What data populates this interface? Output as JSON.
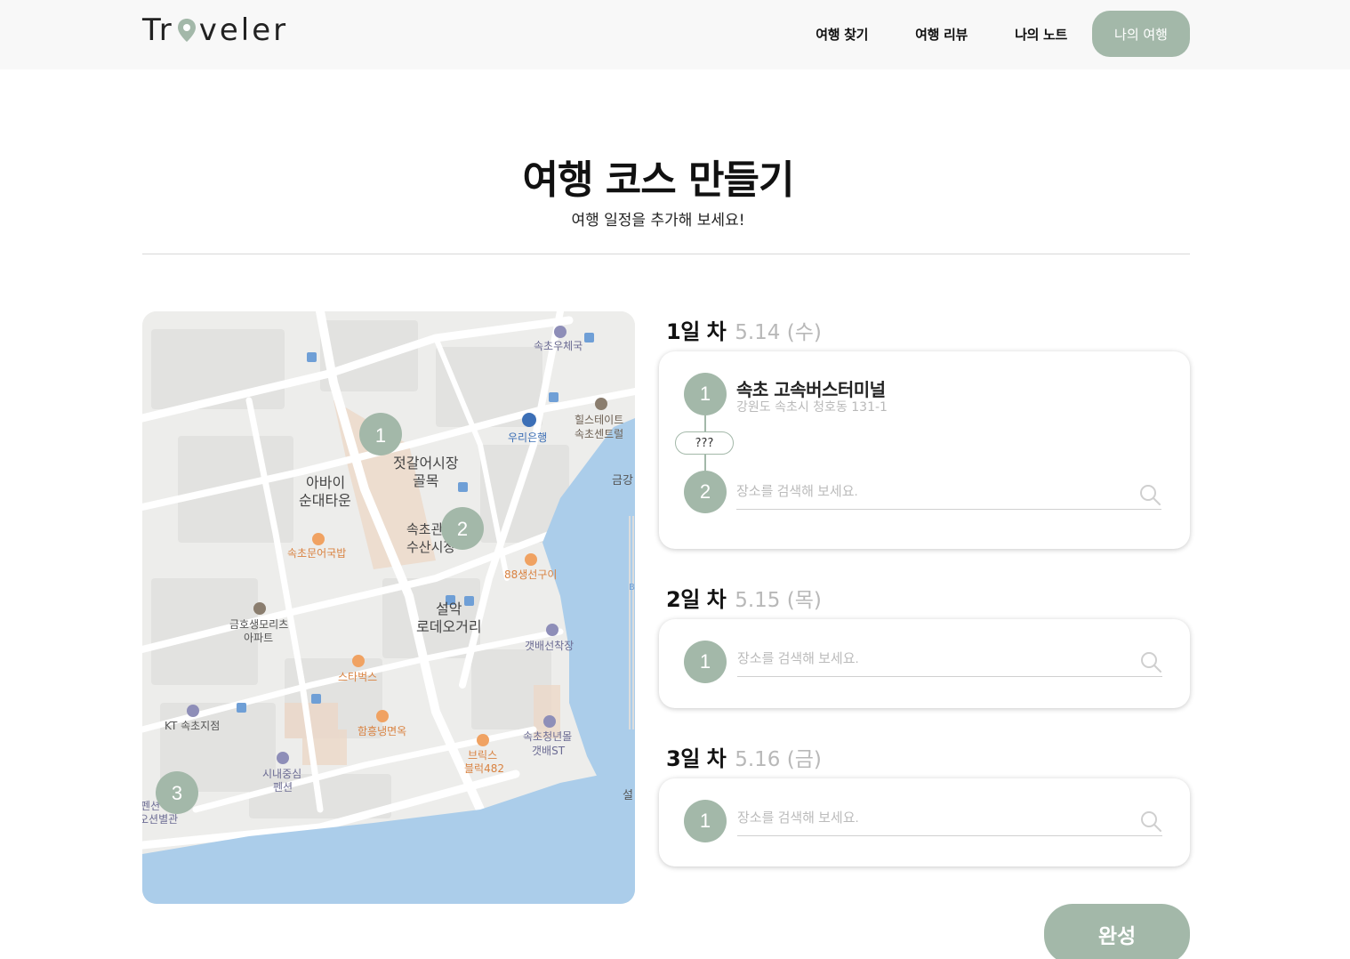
{
  "header": {
    "logo_prefix": "Tr",
    "logo_suffix": "veler",
    "nav": [
      "여행 찾기",
      "여행 리뷰",
      "나의 노트"
    ],
    "nav_active": "나의 여행"
  },
  "page": {
    "title": "여행 코스 만들기",
    "subtitle": "여행 일정을 추가해 보세요!"
  },
  "map": {
    "labels": [
      "속초우체국",
      "우리은행",
      "힐스테이트",
      "속초센트럴",
      "금강",
      "젓갈어시장",
      "골목",
      "아바이",
      "순대타운",
      "속초관광",
      "수산시장",
      "속초문어국밥",
      "88생선구이",
      "설악",
      "로데오거리",
      "금호생모리츠",
      "아파트",
      "갯배선착장",
      "스타벅스",
      "KT 속초지점",
      "함흥냉면옥",
      "속초청년몰",
      "갯배ST",
      "브릭스",
      "블럭482",
      "시내중심",
      "펜션",
      "설",
      "펜션",
      "오션별관",
      "B"
    ],
    "markers": [
      "1",
      "2",
      "3"
    ]
  },
  "days": [
    {
      "label": "1일 차",
      "date": "5.14 (수)",
      "place": {
        "num": "1",
        "name": "속초 고속버스터미널",
        "address": "강원도 속초시 청호동 131-1"
      },
      "gap": "???",
      "next_num": "2",
      "search_placeholder": "장소를 검색해 보세요."
    },
    {
      "label": "2일 차",
      "date": "5.15 (목)",
      "next_num": "1",
      "search_placeholder": "장소를 검색해 보세요."
    },
    {
      "label": "3일 차",
      "date": "5.16 (금)",
      "next_num": "1",
      "search_placeholder": "장소를 검색해 보세요."
    }
  ],
  "done_label": "완성",
  "colors": {
    "accent": "#a3b8a9",
    "water": "#abcdea"
  }
}
